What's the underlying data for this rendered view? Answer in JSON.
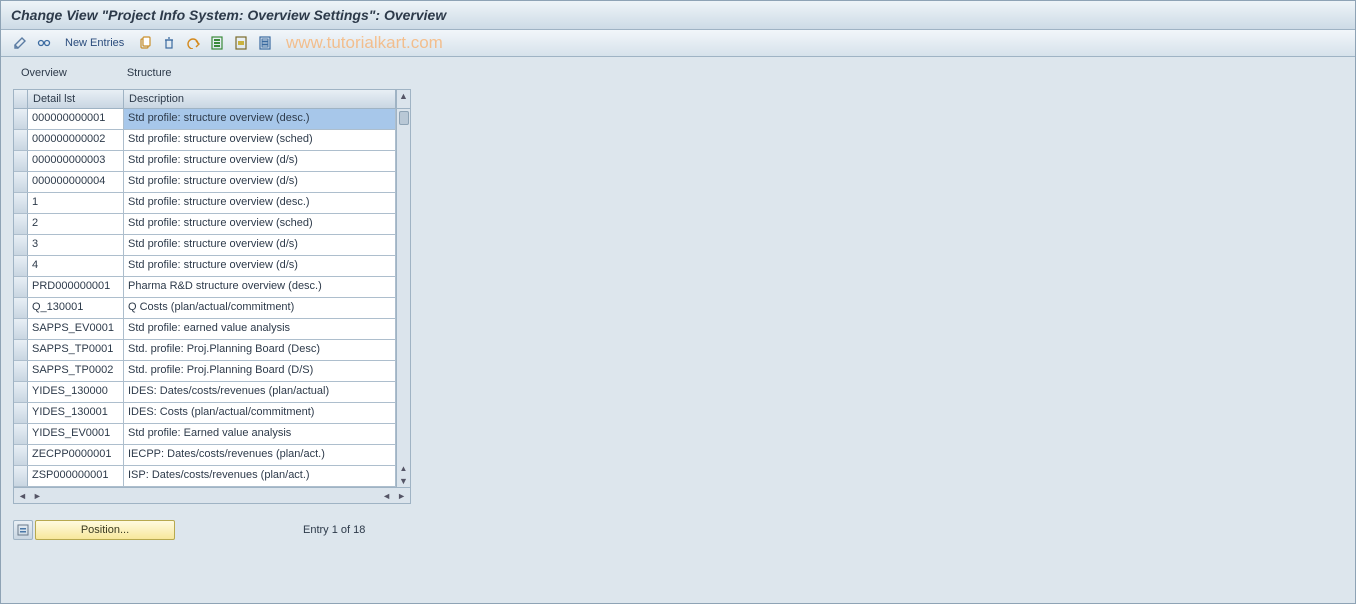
{
  "title": "Change View \"Project Info System: Overview Settings\": Overview",
  "toolbar": {
    "new_entries": "New Entries"
  },
  "watermark": "www.tutorialkart.com",
  "tabs": {
    "overview": "Overview",
    "structure": "Structure"
  },
  "table": {
    "headers": {
      "detail": "Detail lst",
      "desc": "Description"
    },
    "rows": [
      {
        "id": "000000000001",
        "desc": "Std profile: structure overview (desc.)",
        "selected": true
      },
      {
        "id": "000000000002",
        "desc": "Std profile: structure overview (sched)"
      },
      {
        "id": "000000000003",
        "desc": "Std profile: structure overview (d/s)"
      },
      {
        "id": "000000000004",
        "desc": "Std profile: structure overview (d/s)"
      },
      {
        "id": "1",
        "desc": "Std profile: structure overview (desc.)"
      },
      {
        "id": "2",
        "desc": "Std profile: structure overview (sched)"
      },
      {
        "id": "3",
        "desc": "Std profile: structure overview (d/s)"
      },
      {
        "id": "4",
        "desc": "Std profile: structure overview (d/s)"
      },
      {
        "id": "PRD000000001",
        "desc": "Pharma R&D structure overview (desc.)"
      },
      {
        "id": "Q_130001",
        "desc": "Q Costs (plan/actual/commitment)"
      },
      {
        "id": "SAPPS_EV0001",
        "desc": "Std profile: earned value analysis"
      },
      {
        "id": "SAPPS_TP0001",
        "desc": "Std. profile: Proj.Planning Board (Desc)"
      },
      {
        "id": "SAPPS_TP0002",
        "desc": "Std. profile: Proj.Planning Board (D/S)"
      },
      {
        "id": "YIDES_130000",
        "desc": "IDES: Dates/costs/revenues (plan/actual)"
      },
      {
        "id": "YIDES_130001",
        "desc": "IDES: Costs (plan/actual/commitment)"
      },
      {
        "id": "YIDES_EV0001",
        "desc": "Std profile: Earned value analysis"
      },
      {
        "id": "ZECPP0000001",
        "desc": "IECPP: Dates/costs/revenues (plan/act.)"
      },
      {
        "id": "ZSP000000001",
        "desc": "ISP: Dates/costs/revenues (plan/act.)"
      }
    ]
  },
  "footer": {
    "position_label": "Position...",
    "entry_label": "Entry 1 of 18"
  }
}
